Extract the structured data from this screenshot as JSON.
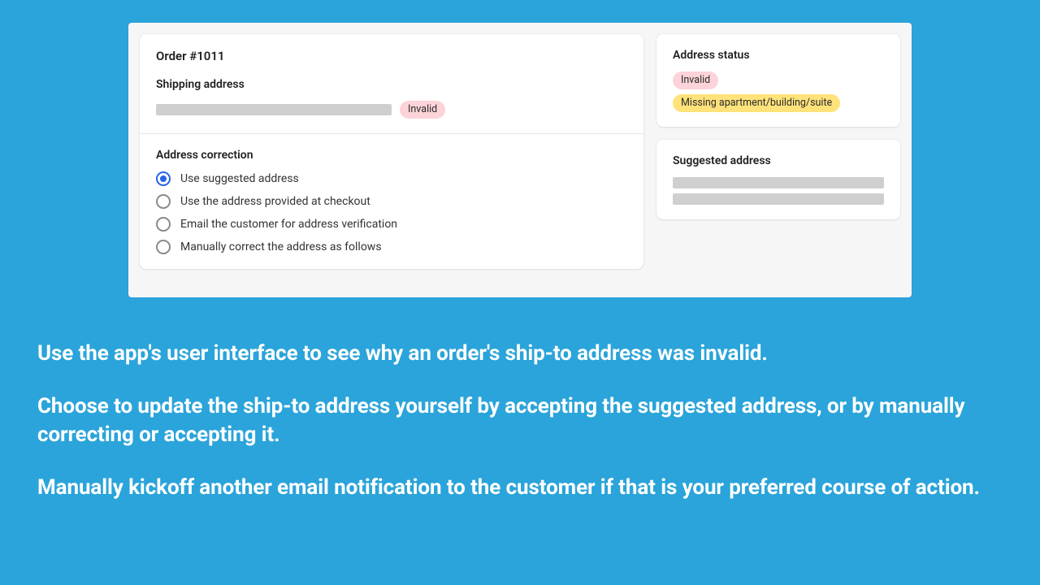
{
  "order": {
    "title": "Order #1011",
    "shipping_heading": "Shipping address",
    "shipping_badge": "Invalid"
  },
  "correction": {
    "heading": "Address correction",
    "options": [
      {
        "label": "Use suggested address",
        "selected": true
      },
      {
        "label": "Use the address provided at checkout",
        "selected": false
      },
      {
        "label": "Email the customer for address verification",
        "selected": false
      },
      {
        "label": "Manually correct the address as follows",
        "selected": false
      }
    ]
  },
  "status": {
    "heading": "Address status",
    "badges": [
      {
        "label": "Invalid",
        "color": "pink"
      },
      {
        "label": "Missing apartment/building/suite",
        "color": "yellow"
      }
    ]
  },
  "suggested": {
    "heading": "Suggested address"
  },
  "copy": {
    "p1": "Use the app's user interface to see why an order's ship-to address was invalid.",
    "p2": "Choose to update the ship-to address yourself by accepting the suggested address, or by manually correcting or accepting it.",
    "p3": "Manually kickoff another email notification to the customer if that is your preferred course of action."
  }
}
